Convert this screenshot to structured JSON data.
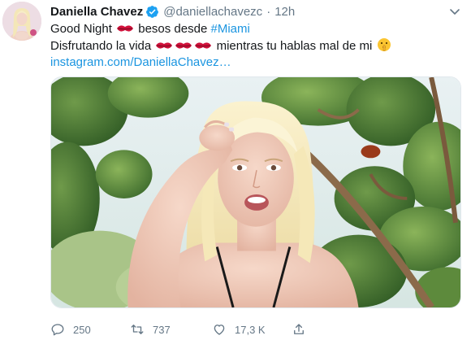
{
  "tweet": {
    "author": {
      "display_name": "Daniella Chavez",
      "handle": "@daniellachavezc",
      "verified": true
    },
    "separator": "·",
    "time": "12h",
    "text": {
      "line1_a": "Good Night",
      "line1_b": "besos desde",
      "line1_hashtag": "#Miami",
      "line2_a": "Disfrutando la vida",
      "line2_b": "mientras tu hablas mal de mi",
      "line3_link": "instagram.com/DaniellaChavez…"
    },
    "emojis": [
      "kiss-mark",
      "kiss-mark",
      "kiss-mark",
      "kiss-mark",
      "shushing-face"
    ],
    "actions": {
      "reply_count": "250",
      "retweet_count": "737",
      "like_count": "17,3 K"
    },
    "colors": {
      "link": "#1b95e0",
      "muted": "#657786",
      "verified": "#1da1f2"
    },
    "icons": [
      "verified-badge-icon",
      "caret-down-icon",
      "reply-icon",
      "retweet-icon",
      "heart-icon",
      "share-icon"
    ]
  }
}
